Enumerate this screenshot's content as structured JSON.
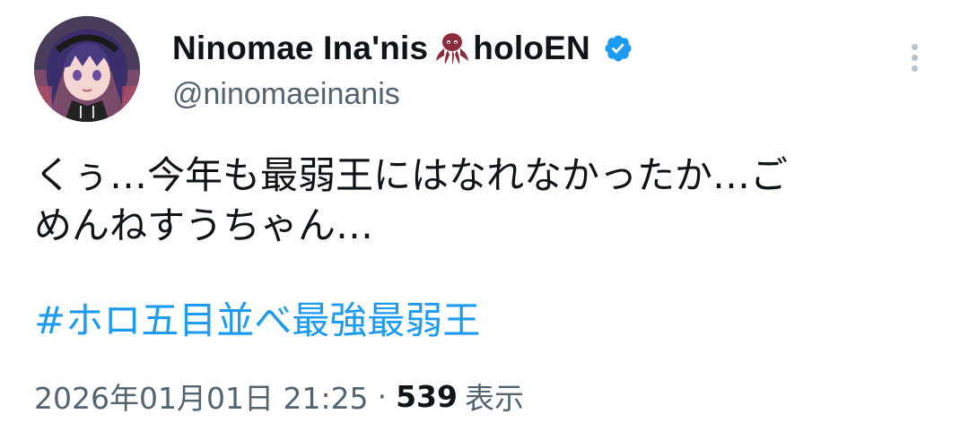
{
  "author": {
    "display_name": "Ninomae Ina'nis",
    "affiliation": "holoEN",
    "handle": "@ninomaeinanis",
    "icons": [
      "octopus-icon",
      "verified-badge-icon"
    ],
    "verified_color": "#1d9bf0"
  },
  "tweet": {
    "text_line1": "くぅ…今年も最弱王にはなれなかったか…ご",
    "text_line2": "めんねすうちゃん…",
    "hashtag": "#ホロ五目並べ最強最弱王"
  },
  "meta": {
    "timestamp": "2026年01月01日 21:25",
    "separator": "·",
    "views_count": "539",
    "views_label": "表示"
  },
  "menu": {
    "icon": "more-vertical-icon"
  },
  "colors": {
    "text": "#0f1419",
    "secondary": "#536471",
    "link": "#1d9bf0"
  }
}
